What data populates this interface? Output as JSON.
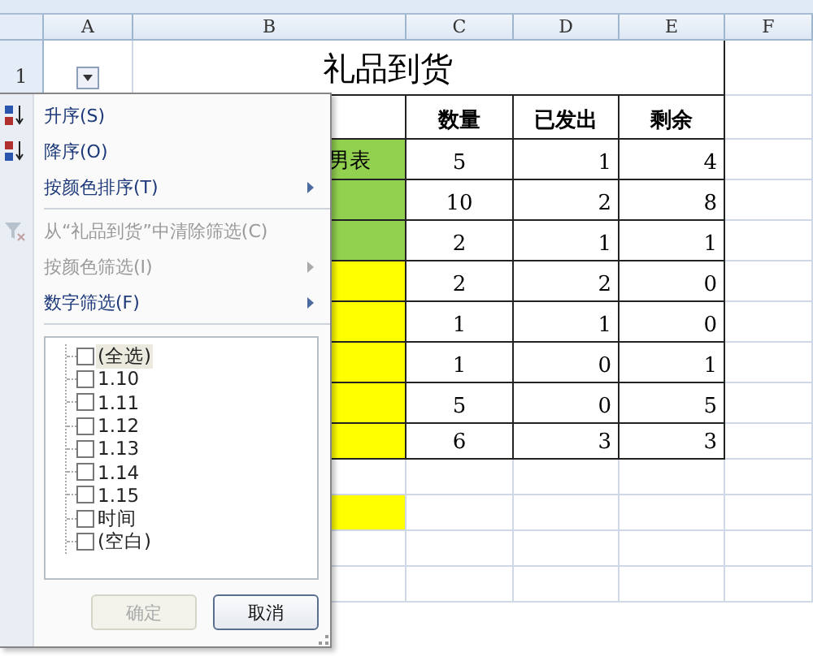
{
  "sheet": {
    "columns": [
      "A",
      "B",
      "C",
      "D",
      "E",
      "F"
    ],
    "title_row": {
      "number": "1",
      "title": "礼品到货"
    },
    "headers": [
      "数量",
      "已发出",
      "剩余"
    ],
    "rows": [
      {
        "name": "男表",
        "quantity": "5",
        "sent": "1",
        "remaining": "4",
        "color": "#92d050"
      },
      {
        "name": "",
        "quantity": "10",
        "sent": "2",
        "remaining": "8",
        "color": "#92d050"
      },
      {
        "name": "",
        "quantity": "2",
        "sent": "1",
        "remaining": "1",
        "color": "#92d050"
      },
      {
        "name": "",
        "quantity": "2",
        "sent": "2",
        "remaining": "0",
        "color": "#ffff00"
      },
      {
        "name": "",
        "quantity": "1",
        "sent": "1",
        "remaining": "0",
        "color": "#ffff00"
      },
      {
        "name": "",
        "quantity": "1",
        "sent": "0",
        "remaining": "1",
        "color": "#ffff00"
      },
      {
        "name": "",
        "quantity": "5",
        "sent": "0",
        "remaining": "5",
        "color": "#ffff00"
      },
      {
        "name": "",
        "quantity": "6",
        "sent": "3",
        "remaining": "3",
        "color": "#ffff00"
      }
    ],
    "blank_rows": [
      {
        "color": "#ffffff"
      },
      {
        "color": "#ffff00"
      },
      {
        "color": "#ffffff"
      },
      {
        "color": "#ffffff"
      }
    ]
  },
  "filter_menu": {
    "items": [
      {
        "kind": "ascending",
        "label": "升序(S)",
        "disabled": false,
        "submenu": false
      },
      {
        "kind": "descending",
        "label": "降序(O)",
        "disabled": false,
        "submenu": false
      },
      {
        "kind": "plain",
        "label": "按颜色排序(T)",
        "disabled": false,
        "submenu": true
      },
      {
        "kind": "separator"
      },
      {
        "kind": "clear",
        "label": "从“礼品到货”中清除筛选(C)",
        "disabled": true,
        "submenu": false
      },
      {
        "kind": "plain",
        "label": "按颜色筛选(I)",
        "disabled": true,
        "submenu": true
      },
      {
        "kind": "plain",
        "label": "数字筛选(F)",
        "disabled": false,
        "submenu": true
      }
    ],
    "values": [
      {
        "label": "(全选)",
        "checked": false,
        "highlighted": true
      },
      {
        "label": "1.10",
        "checked": false,
        "highlighted": false
      },
      {
        "label": "1.11",
        "checked": false,
        "highlighted": false
      },
      {
        "label": "1.12",
        "checked": false,
        "highlighted": false
      },
      {
        "label": "1.13",
        "checked": false,
        "highlighted": false
      },
      {
        "label": "1.14",
        "checked": false,
        "highlighted": false
      },
      {
        "label": "1.15",
        "checked": false,
        "highlighted": false
      },
      {
        "label": "时间",
        "checked": false,
        "highlighted": false
      },
      {
        "label": "(空白)",
        "checked": false,
        "highlighted": false
      }
    ],
    "buttons": [
      {
        "label": "确定",
        "disabled": true
      },
      {
        "label": "取消",
        "disabled": false
      }
    ]
  }
}
